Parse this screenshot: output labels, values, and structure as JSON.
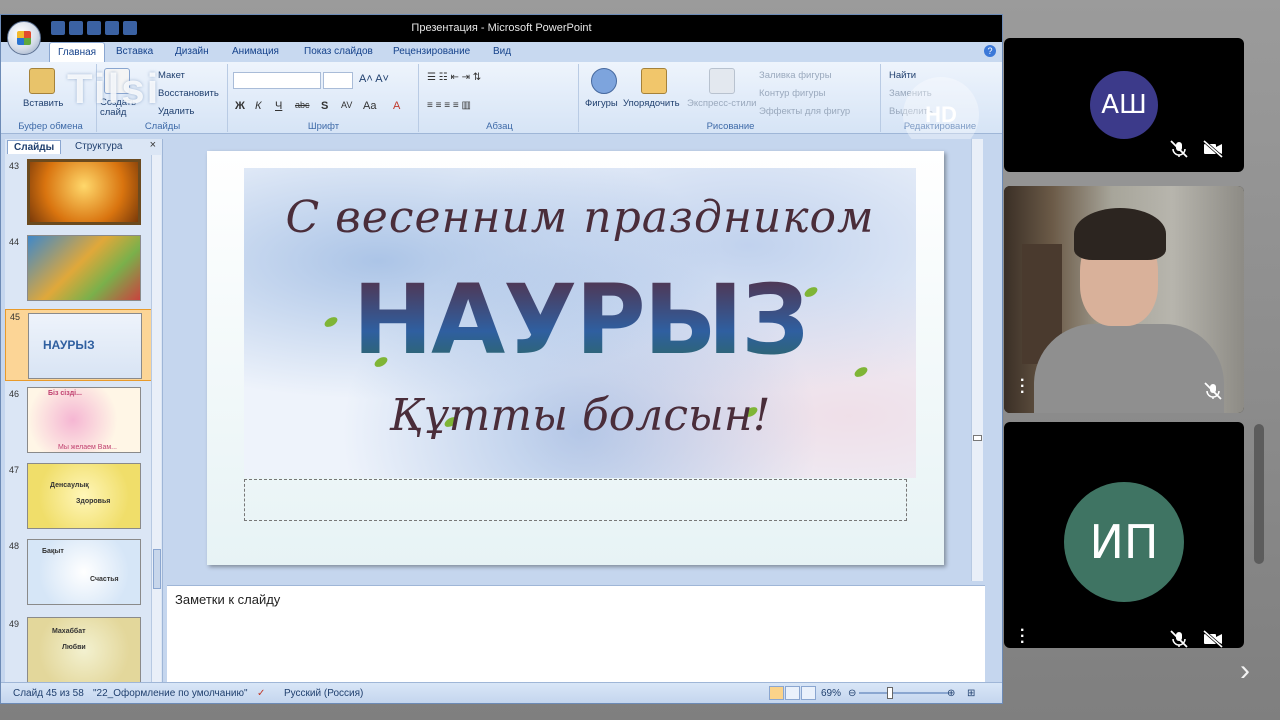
{
  "window": {
    "title": "Презентация - Microsoft PowerPoint"
  },
  "ribbon": {
    "tabs": [
      "Главная",
      "Вставка",
      "Дизайн",
      "Анимация",
      "Показ слайдов",
      "Рецензирование",
      "Вид"
    ],
    "groups": {
      "clipboard": {
        "label": "Буфер обмена",
        "paste": "Вставить"
      },
      "slides": {
        "label": "Слайды",
        "create": "Создать слайд",
        "layout": "Макет",
        "restore": "Восстановить",
        "delete": "Удалить"
      },
      "font": {
        "label": "Шрифт"
      },
      "paragraph": {
        "label": "Абзац"
      },
      "drawing": {
        "label": "Рисование",
        "shapes": "Фигуры",
        "arrange": "Упорядочить",
        "express": "Экспресс-стили",
        "fill": "Заливка фигуры",
        "outline": "Контур фигуры",
        "effects": "Эффекты для фигур"
      },
      "editing": {
        "label": "Редактирование",
        "find": "Найти",
        "replace": "Заменить",
        "select": "Выделить"
      }
    },
    "watermark": "Tilsi",
    "hd_badge": "HD"
  },
  "slides_pane": {
    "tabs": [
      "Слайды",
      "Структура"
    ],
    "close": "×",
    "thumbnails": [
      {
        "num": "43",
        "label": ""
      },
      {
        "num": "44",
        "label": ""
      },
      {
        "num": "45",
        "label": "НАУРЫЗ",
        "selected": true
      },
      {
        "num": "46",
        "label": "Біз сізді...",
        "sub": "Мы желаем Вам..."
      },
      {
        "num": "47",
        "label": "Денсаулық",
        "sub": "Здоровья"
      },
      {
        "num": "48",
        "label": "Бақыт",
        "sub": "Счастья"
      },
      {
        "num": "49",
        "label": "Махаббат",
        "sub": "Любви"
      }
    ]
  },
  "slide": {
    "top_line": "С весенним праздником",
    "main": "НАУРЫЗ",
    "bottom_line": "Құтты болсын!"
  },
  "notes": {
    "placeholder": "Заметки к слайду"
  },
  "status": {
    "slide": "Слайд 45 из 58",
    "theme": "\"22_Оформление по умолчанию\"",
    "language": "Русский (Россия)",
    "zoom": "69%"
  },
  "participants": [
    {
      "initials": "АШ",
      "color": "#3c3a8a",
      "mic_muted": true,
      "cam_off": true
    },
    {
      "initials": "",
      "video": true,
      "mic_muted": true
    },
    {
      "initials": "ИП",
      "color": "#3f7463",
      "mic_muted": true,
      "cam_off": true
    }
  ],
  "colors": {
    "ribbon_text": "#15428b",
    "ppt_bg": "#c5d6ee",
    "tile_bg": "#000000"
  }
}
